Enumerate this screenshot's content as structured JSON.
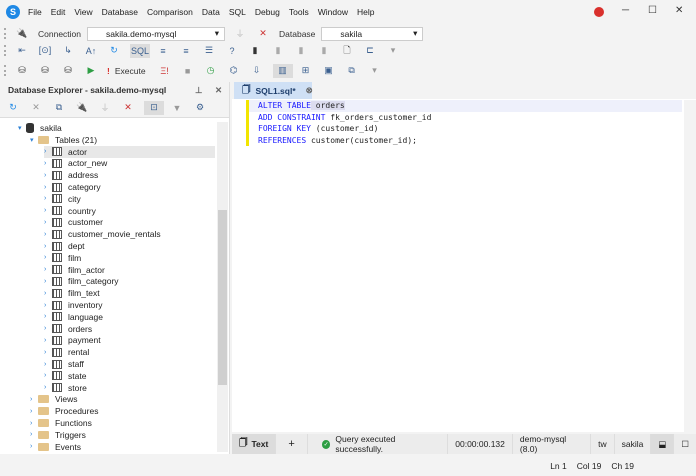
{
  "menu": [
    "File",
    "Edit",
    "View",
    "Database",
    "Comparison",
    "Data",
    "SQL",
    "Debug",
    "Tools",
    "Window",
    "Help"
  ],
  "toolbar": {
    "connection_label": "Connection",
    "connection_value": "sakila.demo-mysql",
    "database_label": "Database",
    "database_value": "sakila",
    "execute_label": "Execute"
  },
  "explorer": {
    "title": "Database Explorer - sakila.demo-mysql",
    "db": "sakila",
    "tables_label": "Tables (21)",
    "tables": [
      "actor",
      "actor_new",
      "address",
      "category",
      "city",
      "country",
      "customer",
      "customer_movie_rentals",
      "dept",
      "film",
      "film_actor",
      "film_category",
      "film_text",
      "inventory",
      "language",
      "orders",
      "payment",
      "rental",
      "staff",
      "state",
      "store"
    ],
    "folders": [
      "Views",
      "Procedures",
      "Functions",
      "Triggers",
      "Events"
    ]
  },
  "editor": {
    "tab": "SQL1.sql*",
    "lines": [
      {
        "kw": "ALTER TABLE",
        "rest": " orders"
      },
      {
        "kw": "ADD CONSTRAINT",
        "rest": " fk_orders_customer_id"
      },
      {
        "kw": "FOREIGN KEY",
        "rest": " (customer_id)"
      },
      {
        "kw": "REFERENCES",
        "rest": " customer(customer_id);"
      }
    ]
  },
  "results": {
    "text_tab": "Text",
    "add": "+",
    "message": "Query executed successfully.",
    "time": "00:00:00.132",
    "server": "demo-mysql (8.0)",
    "user": "tw",
    "db": "sakila"
  },
  "status": {
    "ln": "Ln 1",
    "col": "Col 19",
    "ch": "Ch 19"
  },
  "colors": {
    "accent": "#1e88e5",
    "success": "#2e9e44"
  }
}
